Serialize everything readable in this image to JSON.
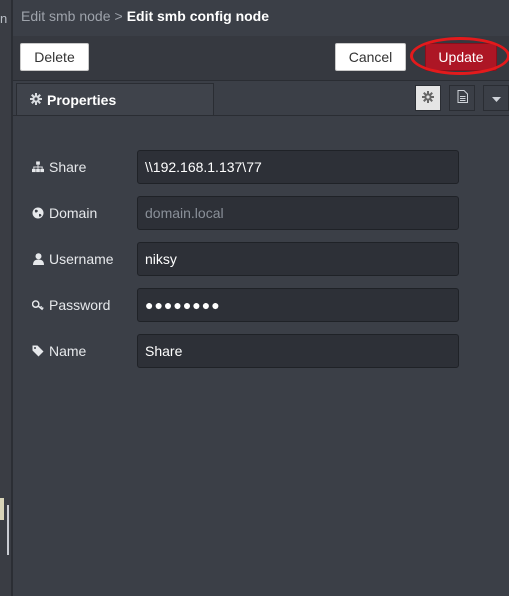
{
  "breadcrumb": {
    "parent": "Edit smb node",
    "separator": ">",
    "current": "Edit smb config node"
  },
  "toolbar": {
    "delete_label": "Delete",
    "cancel_label": "Cancel",
    "update_label": "Update"
  },
  "tabs": {
    "properties_label": "Properties",
    "icons": [
      "gear-icon",
      "document-icon",
      "caret-down-icon"
    ]
  },
  "form": {
    "share": {
      "label": "Share",
      "value": "\\\\192.168.1.137\\77",
      "icon": "sitemap-icon"
    },
    "domain": {
      "label": "Domain",
      "value": "",
      "placeholder": "domain.local",
      "icon": "globe-icon"
    },
    "username": {
      "label": "Username",
      "value": "niksy",
      "icon": "user-icon"
    },
    "password": {
      "label": "Password",
      "value": "●●●●●●●●",
      "icon": "key-icon"
    },
    "name": {
      "label": "Name",
      "value": "Share",
      "icon": "tag-icon"
    }
  },
  "colors": {
    "update_button": "#ad1625",
    "highlight_ring": "#e31a1c",
    "panel_bg": "#3b3f47",
    "input_bg": "#2d3037"
  },
  "left_strip": {
    "char": "n"
  }
}
